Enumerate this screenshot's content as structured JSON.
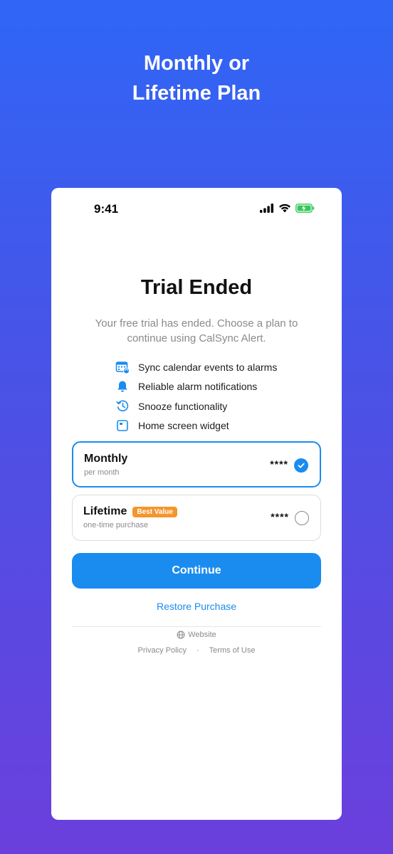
{
  "headline": {
    "line1": "Monthly or",
    "line2": "Lifetime Plan"
  },
  "status_bar": {
    "time": "9:41",
    "icons": [
      "signal-icon",
      "wifi-icon",
      "battery-charging-icon"
    ]
  },
  "paywall": {
    "title": "Trial Ended",
    "subtitle": "Your free trial has ended. Choose a plan to continue using CalSync Alert.",
    "features": [
      {
        "icon": "calendar-sync-icon",
        "label": "Sync calendar events to alarms"
      },
      {
        "icon": "bell-icon",
        "label": "Reliable alarm notifications"
      },
      {
        "icon": "snooze-clock-icon",
        "label": "Snooze functionality"
      },
      {
        "icon": "widget-icon",
        "label": "Home screen widget"
      }
    ],
    "plans": [
      {
        "name": "Monthly",
        "sub": "per month",
        "price": "****",
        "selected": true
      },
      {
        "name": "Lifetime",
        "badge": "Best Value",
        "sub": "one-time purchase",
        "price": "****",
        "selected": false
      }
    ],
    "continue_label": "Continue",
    "restore_label": "Restore Purchase",
    "website_label": "Website",
    "privacy_label": "Privacy Policy",
    "separator": "·",
    "terms_label": "Terms of Use"
  },
  "colors": {
    "accent": "#1a8cf0",
    "badge": "#f5952c",
    "gradient_top": "#2f66f6",
    "gradient_bottom": "#6b3fdc"
  }
}
